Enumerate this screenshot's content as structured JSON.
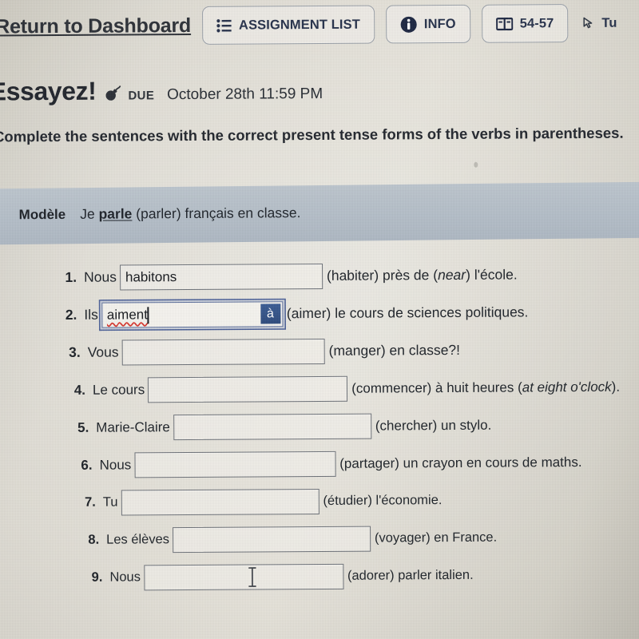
{
  "toolbar": {
    "return_label": "Return to Dashboard",
    "assignment_list_label": "ASSIGNMENT LIST",
    "assignment_list_icon": "list-icon",
    "info_label": "INFO",
    "info_icon": "info-circle-icon",
    "pages_label": "54-57",
    "pages_icon": "book-icon",
    "tutorial_label": "Tu",
    "tutorial_icon": "cursor-arrow-icon"
  },
  "header": {
    "title": "Essayez!",
    "due_icon": "bomb-icon",
    "due_label": "DUE",
    "due_date": "October 28th 11:59 PM",
    "instructions": "Complete the sentences with the correct present tense forms of the verbs in parentheses."
  },
  "modele": {
    "label": "Modèle",
    "before": "Je ",
    "answer": "parle",
    "after": " (parler) français en classe."
  },
  "colors": {
    "accent_blue": "#2c4a7c",
    "toolbar_text": "#25304a",
    "band_gray": "#b4bec8",
    "spellcheck_red": "#d6342c"
  },
  "exercises": [
    {
      "num": "1.",
      "lead": "Nous",
      "value": "habitons",
      "tail_pre": "(habiter) près de (",
      "tail_italic": "near",
      "tail_post": ") l'école.",
      "field_width": 252,
      "focused": false,
      "spellcheck": false
    },
    {
      "num": "2.",
      "lead": "Ils",
      "value": "aiment",
      "tail_pre": "(aimer) le cours de sciences politiques.",
      "tail_italic": "",
      "tail_post": "",
      "field_width": 225,
      "focused": true,
      "spellcheck": true,
      "accent_button": "à"
    },
    {
      "num": "3.",
      "lead": "Vous",
      "value": "",
      "tail_pre": "(manger) en classe?!",
      "tail_italic": "",
      "tail_post": "",
      "field_width": 252,
      "focused": false,
      "spellcheck": false
    },
    {
      "num": "4.",
      "lead": "Le cours",
      "value": "",
      "tail_pre": "(commencer) à huit heures (",
      "tail_italic": "at eight o'clock",
      "tail_post": ").",
      "field_width": 248,
      "focused": false,
      "spellcheck": false
    },
    {
      "num": "5.",
      "lead": "Marie-Claire",
      "value": "",
      "tail_pre": "(chercher) un stylo.",
      "tail_italic": "",
      "tail_post": "",
      "field_width": 246,
      "focused": false,
      "spellcheck": false
    },
    {
      "num": "6.",
      "lead": "Nous",
      "value": "",
      "tail_pre": "(partager) un crayon en cours de maths.",
      "tail_italic": "",
      "tail_post": "",
      "field_width": 250,
      "focused": false,
      "spellcheck": false
    },
    {
      "num": "7.",
      "lead": "Tu",
      "value": "",
      "tail_pre": "(étudier) l'économie.",
      "tail_italic": "",
      "tail_post": "",
      "field_width": 246,
      "focused": false,
      "spellcheck": false
    },
    {
      "num": "8.",
      "lead": "Les élèves",
      "value": "",
      "tail_pre": "(voyager) en France.",
      "tail_italic": "",
      "tail_post": "",
      "field_width": 246,
      "focused": false,
      "spellcheck": false
    },
    {
      "num": "9.",
      "lead": "Nous",
      "value": "",
      "tail_pre": "(adorer) parler italien.",
      "tail_italic": "",
      "tail_post": "",
      "field_width": 248,
      "focused": false,
      "spellcheck": false,
      "cursor": "ibeam-cursor"
    }
  ]
}
